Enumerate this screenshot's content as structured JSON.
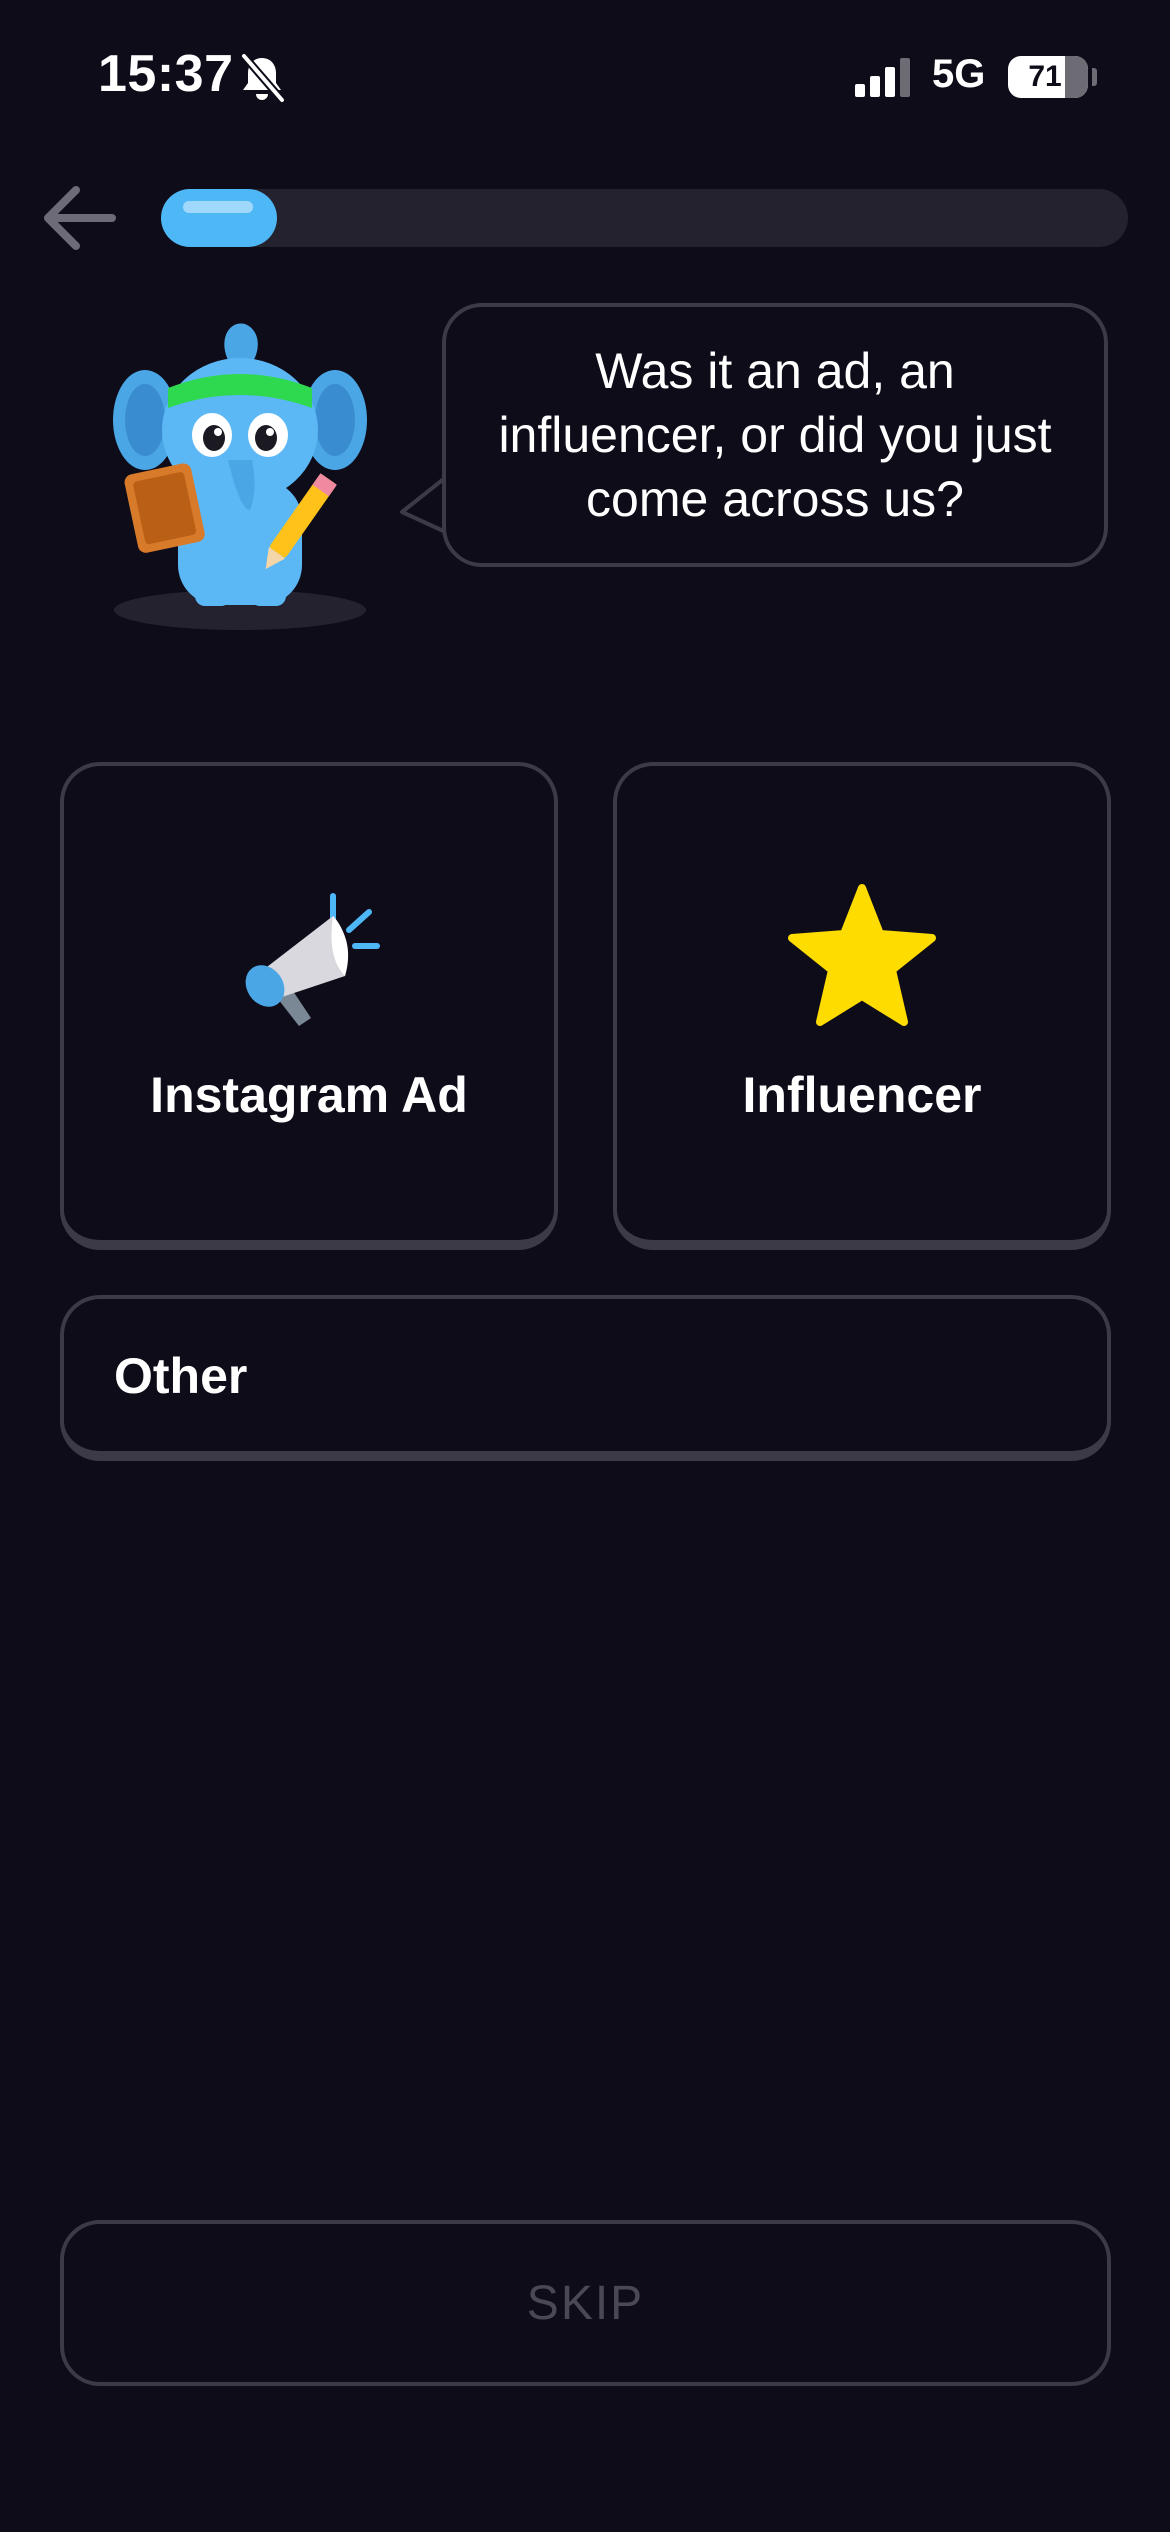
{
  "status_bar": {
    "time": "15:37",
    "network": "5G",
    "battery_level": "71",
    "battery_fraction": 0.71,
    "icons": [
      "bell-slash-icon",
      "signal-bars-icon",
      "battery-icon"
    ]
  },
  "header": {
    "back_icon": "arrow-left-icon",
    "progress_fraction": 0.12,
    "colors": {
      "accent": "#4eb7f6",
      "track": "#24222e"
    }
  },
  "mascot": {
    "icon": "elephant-mascot-icon"
  },
  "question": {
    "text": "Was it an ad, an influencer, or did you just come across us?"
  },
  "options": [
    {
      "label": "Instagram Ad",
      "icon": "megaphone-icon"
    },
    {
      "label": "Influencer",
      "icon": "star-icon"
    },
    {
      "label": "Other"
    }
  ],
  "footer": {
    "skip_label": "SKIP"
  },
  "colors": {
    "background": "#0e0c18",
    "card_border": "#3d3a48",
    "star": "#ffdc00",
    "muted_text": "#4b4856"
  }
}
